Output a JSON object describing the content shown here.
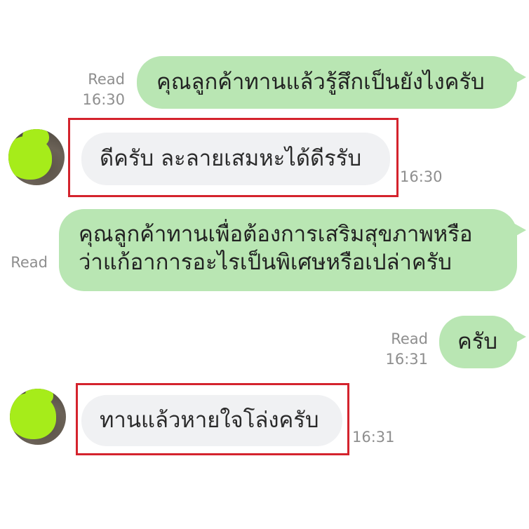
{
  "messages": [
    {
      "id": "m1",
      "direction": "outgoing",
      "lines": [
        "คุณลูกค้าทานแล้วรู้สึกเป็นยังไงครับ"
      ],
      "status": "Read",
      "time": "16:30"
    },
    {
      "id": "m2",
      "direction": "incoming",
      "lines": [
        "ดีครับ ละลายเสมหะได้ดีรรับ"
      ],
      "time": "16:30",
      "highlighted": true
    },
    {
      "id": "m3",
      "direction": "outgoing",
      "lines": [
        "คุณลูกค้าทานเพื่อต้องการเสริมสุขภาพหรือ",
        "ว่าแก้อาการอะไรเป็นพิเศษหรือเปล่าครับ"
      ],
      "status": "Read",
      "time": ""
    },
    {
      "id": "m4",
      "direction": "outgoing",
      "lines": [
        "ครับ"
      ],
      "status": "Read",
      "time": "16:31"
    },
    {
      "id": "m5",
      "direction": "incoming",
      "lines": [
        "ทานแล้วหายใจโล่งครับ"
      ],
      "time": "16:31",
      "highlighted": true
    }
  ],
  "colors": {
    "outgoing_bubble": "#b9e6b3",
    "incoming_bubble": "#f0f1f3",
    "highlight_border": "#d4232d",
    "avatar_blob": "#a6ec1a",
    "meta_text": "#8e8e8e"
  }
}
